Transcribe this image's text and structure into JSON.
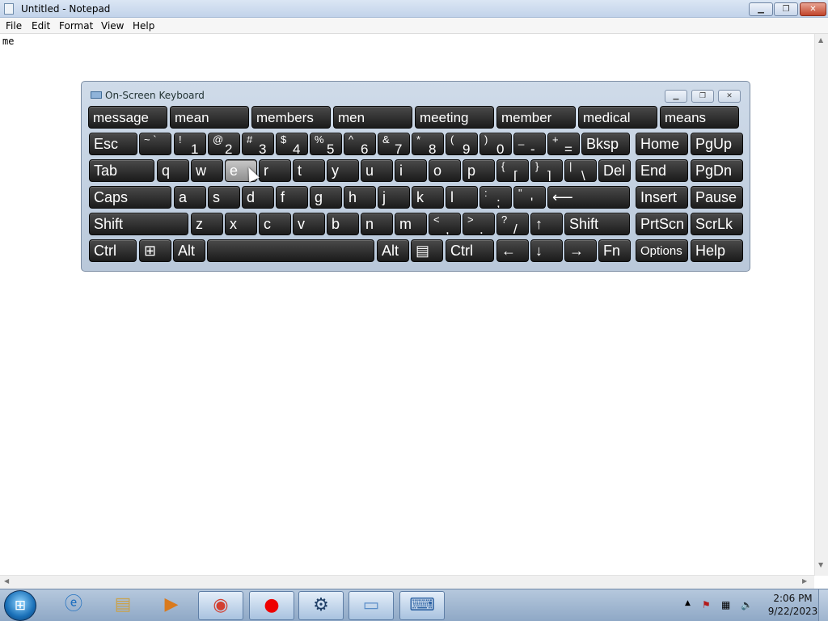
{
  "window": {
    "title": "Untitled - Notepad"
  },
  "menubar": [
    "File",
    "Edit",
    "Format",
    "View",
    "Help"
  ],
  "document": {
    "text": "me"
  },
  "osk": {
    "title": "On-Screen Keyboard",
    "suggestions": [
      "message",
      "mean",
      "members",
      "men",
      "meeting",
      "member",
      "medical",
      "means"
    ],
    "row1": [
      [
        "Esc",
        ""
      ],
      [
        "",
        "~ `"
      ],
      [
        "1",
        "!"
      ],
      [
        "2",
        "@"
      ],
      [
        "3",
        "#"
      ],
      [
        "4",
        "$"
      ],
      [
        "5",
        "%"
      ],
      [
        "6",
        "^"
      ],
      [
        "7",
        "&"
      ],
      [
        "8",
        "*"
      ],
      [
        "9",
        "("
      ],
      [
        "0",
        ")"
      ],
      [
        "-",
        "_"
      ],
      [
        "=",
        "+"
      ],
      [
        "Bksp",
        ""
      ]
    ],
    "row2": [
      "Tab",
      "q",
      "w",
      "e",
      "r",
      "t",
      "y",
      "u",
      "i",
      "o",
      "p",
      [
        "[",
        "{"
      ],
      [
        "]",
        "}"
      ],
      [
        "\\",
        "|"
      ],
      "Del"
    ],
    "row3": [
      "Caps",
      "a",
      "s",
      "d",
      "f",
      "g",
      "h",
      "j",
      "k",
      "l",
      [
        ";",
        ":"
      ],
      [
        "'",
        "\""
      ],
      "⟵"
    ],
    "row4": [
      "Shift",
      "z",
      "x",
      "c",
      "v",
      "b",
      "n",
      "m",
      [
        ",",
        "<"
      ],
      [
        ".",
        ">"
      ],
      [
        "/",
        "?"
      ],
      "↑",
      "Shift"
    ],
    "row5": [
      "Ctrl",
      "⊞",
      "Alt",
      "",
      "Alt",
      "▤",
      "Ctrl",
      "←",
      "↓",
      "→",
      "Fn"
    ],
    "nav": [
      "Home",
      "PgUp",
      "End",
      "PgDn",
      "Insert",
      "Pause",
      "PrtScn",
      "ScrLk",
      "Options",
      "Help"
    ],
    "pressed_key": "e"
  },
  "taskbar": {
    "apps": [
      "internet-explorer",
      "file-explorer",
      "media-player",
      "chrome",
      "screen-recorder",
      "network-app",
      "notepad",
      "on-screen-keyboard"
    ],
    "clock": {
      "time": "2:06 PM",
      "date": "9/22/2023"
    }
  }
}
